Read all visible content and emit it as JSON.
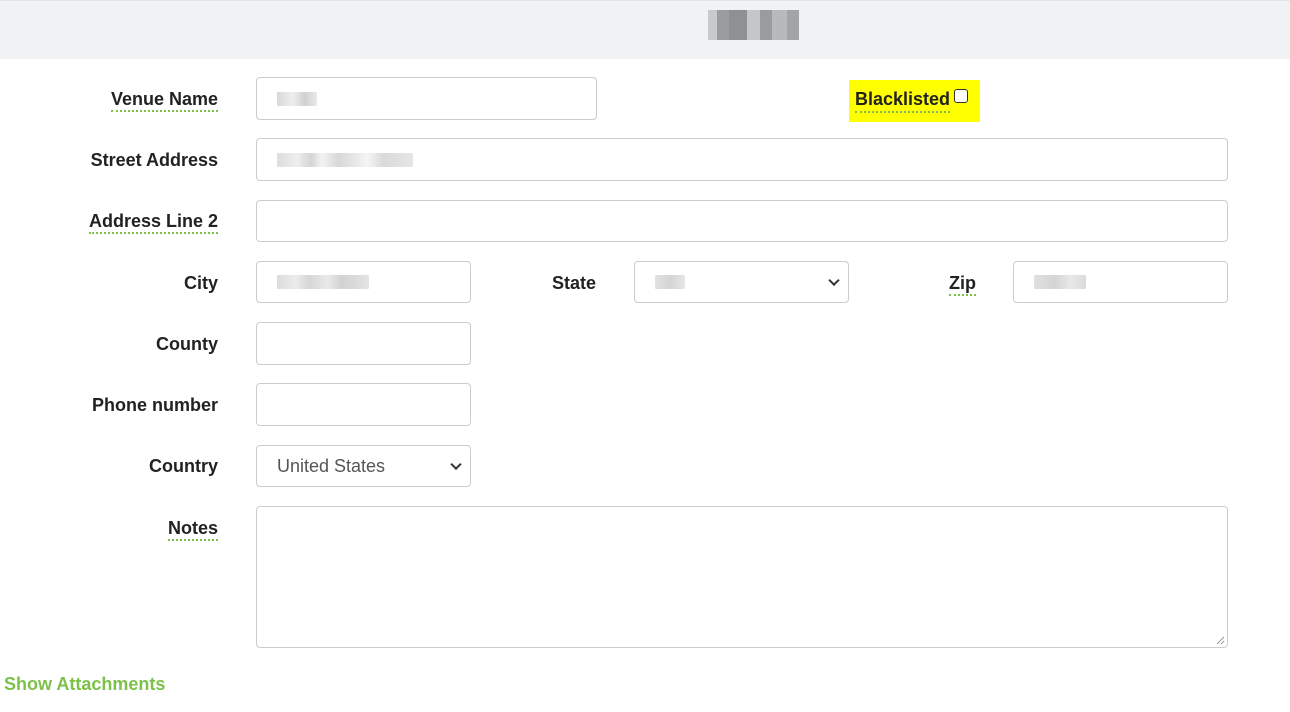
{
  "form": {
    "venue_name_label": "Venue Name",
    "blacklisted_label": "Blacklisted",
    "street_address_label": "Street Address",
    "address_line2_label": "Address Line 2",
    "city_label": "City",
    "state_label": "State",
    "zip_label": "Zip",
    "county_label": "County",
    "phone_label": "Phone number",
    "country_label": "Country",
    "country_value": "United States",
    "notes_label": "Notes"
  },
  "links": {
    "show_attachments": "Show Attachments"
  },
  "colors": {
    "accent_green": "#7cc24a",
    "highlight_yellow": "#ffff00"
  }
}
